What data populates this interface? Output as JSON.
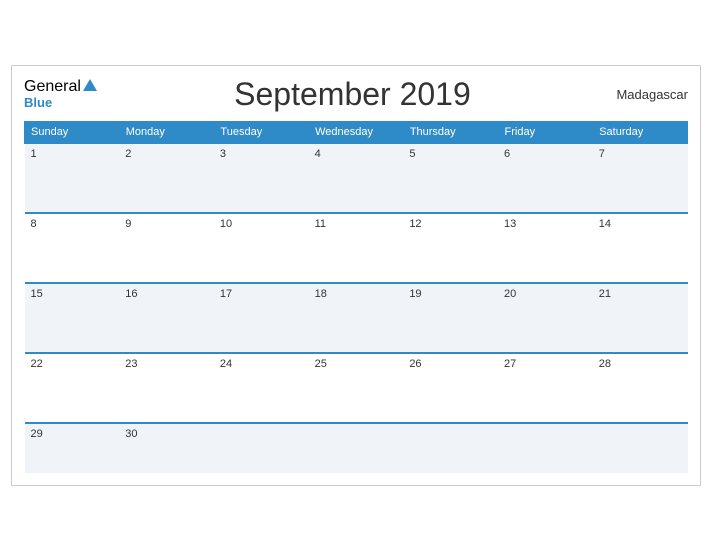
{
  "header": {
    "logo_general": "General",
    "logo_blue": "Blue",
    "title": "September 2019",
    "country": "Madagascar"
  },
  "days": [
    "Sunday",
    "Monday",
    "Tuesday",
    "Wednesday",
    "Thursday",
    "Friday",
    "Saturday"
  ],
  "weeks": [
    [
      "1",
      "2",
      "3",
      "4",
      "5",
      "6",
      "7"
    ],
    [
      "8",
      "9",
      "10",
      "11",
      "12",
      "13",
      "14"
    ],
    [
      "15",
      "16",
      "17",
      "18",
      "19",
      "20",
      "21"
    ],
    [
      "22",
      "23",
      "24",
      "25",
      "26",
      "27",
      "28"
    ],
    [
      "29",
      "30",
      "",
      "",
      "",
      "",
      ""
    ]
  ]
}
